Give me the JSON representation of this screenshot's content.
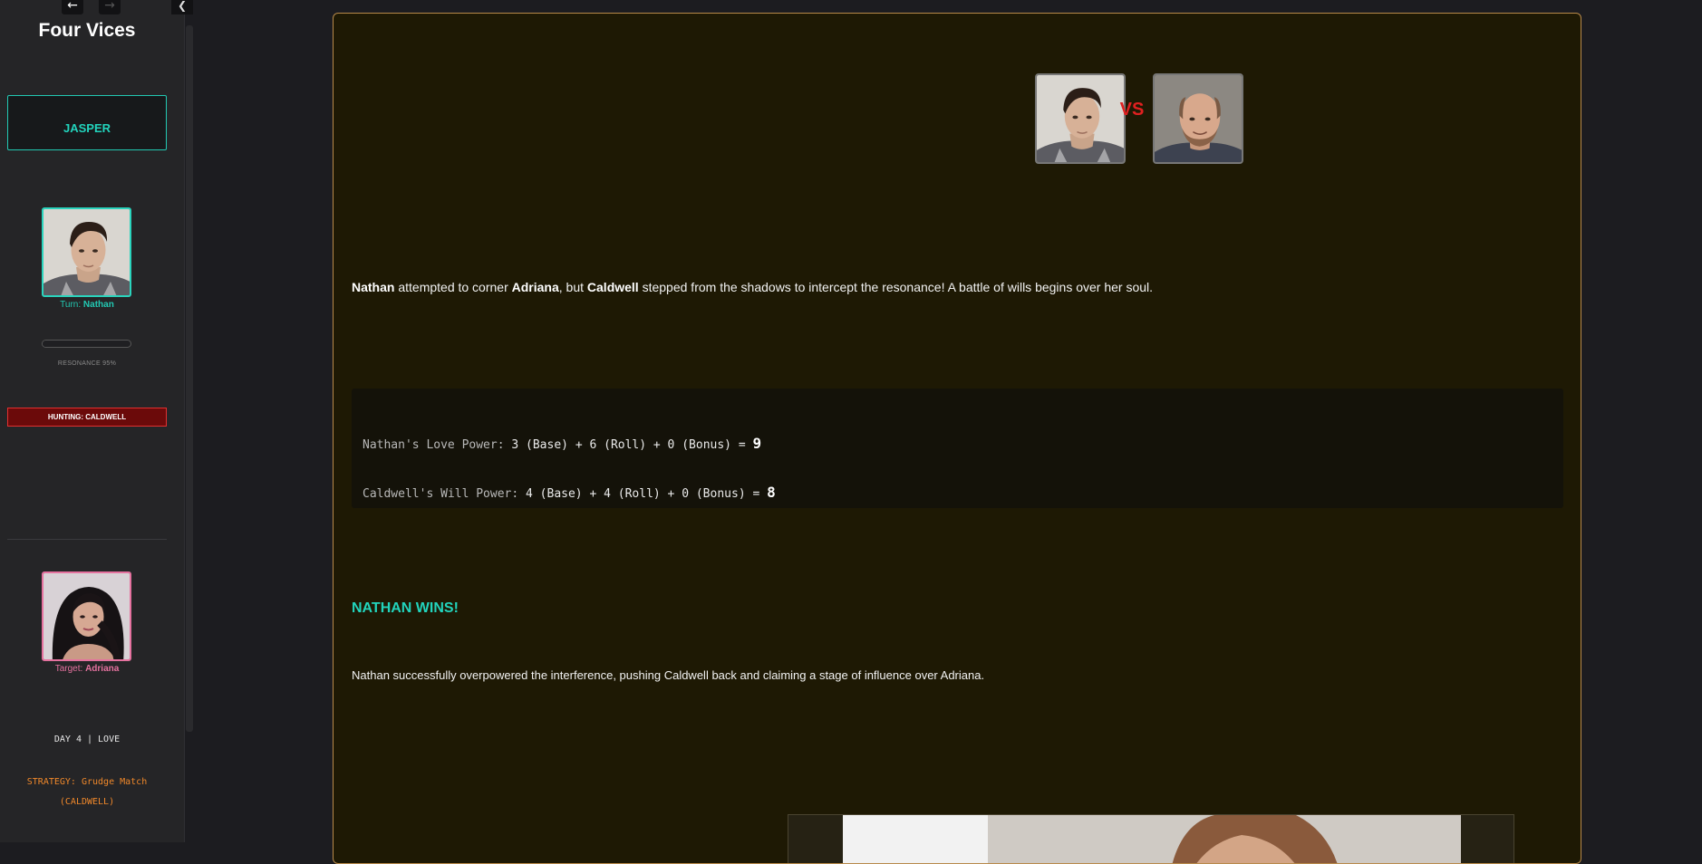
{
  "sidebar": {
    "nav_back_icon": "arrow-left-icon",
    "nav_forward_icon": "arrow-right-icon",
    "toggle_icon": "chevron-left-icon",
    "app_title": "Four Vices",
    "player_name": "JASPER",
    "turn_prefix": "Turn: ",
    "turn_name": "Nathan",
    "resonance_label": "RESONANCE 95%",
    "resonance_value": 0.95,
    "hunting_label": "HUNTING: CALDWELL",
    "target_prefix": "Target: ",
    "target_name": "Adriana",
    "day_label": "DAY 4 | LOVE",
    "strategy_line1": "STRATEGY: Grudge Match",
    "strategy_line2": "(CALDWELL)"
  },
  "encounter": {
    "vs_label": "VS",
    "intro": {
      "actor": "Nathan",
      "part1": " attempted to corner ",
      "target": "Adriana",
      "part2": ", but ",
      "interceptor": "Caldwell",
      "part3": " stepped from the shadows to intercept the resonance! A battle of wills begins over her soul."
    },
    "power_lines": [
      {
        "name": "Nathan's Love Power:",
        "formula": " 3 (Base) + 6 (Roll) + 0 (Bonus) = ",
        "total": "9"
      },
      {
        "name": "Caldwell's Will Power:",
        "formula": " 4 (Base) + 4 (Roll) + 0 (Bonus) = ",
        "total": "8"
      }
    ],
    "winner_heading": "NATHAN WINS!",
    "outcome": "Nathan successfully overpowered the interference, pushing Caldwell back and claiming a stage of influence over Adriana."
  },
  "colors": {
    "accent_teal": "#22d4bd",
    "target_pink": "#e5729f",
    "hunting_red": "#6b0a0a",
    "vs_red": "#e02020",
    "strategy_orange": "#f0882a",
    "card_border": "#b88a4a"
  }
}
